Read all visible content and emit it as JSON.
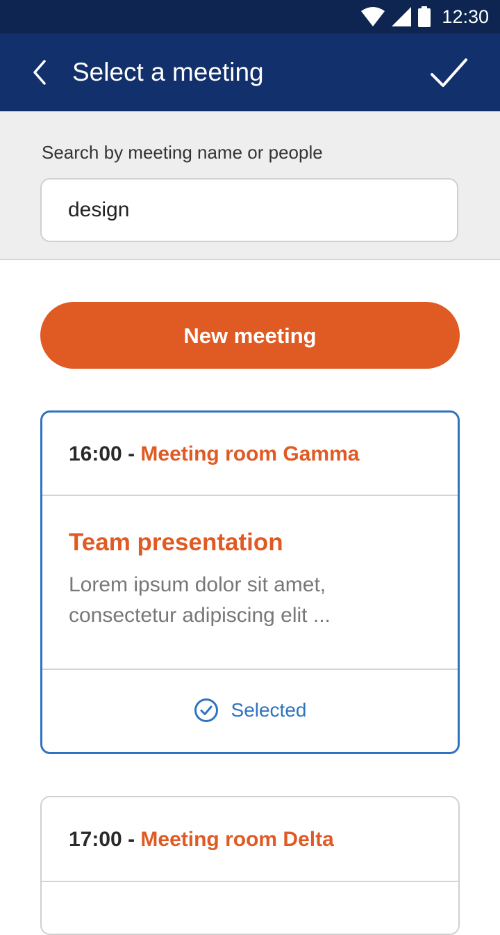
{
  "status_bar": {
    "time": "12:30",
    "icons": [
      "wifi-icon",
      "signal-icon",
      "battery-icon"
    ]
  },
  "app_bar": {
    "title": "Select a meeting",
    "back_icon": "chevron-left-icon",
    "confirm_icon": "check-icon"
  },
  "search": {
    "label": "Search by meeting name or people",
    "value": "design"
  },
  "new_meeting_label": "New meeting",
  "meetings": [
    {
      "time": "16:00",
      "separator": " - ",
      "room": "Meeting room Gamma",
      "name": "Team presentation",
      "description": "Lorem ipsum dolor sit amet, consectetur adipiscing elit ...",
      "status": "Selected"
    },
    {
      "time": "17:00",
      "separator": " - ",
      "room": "Meeting room Delta"
    }
  ],
  "colors": {
    "status_bar": "#0d2550",
    "app_bar": "#12306b",
    "accent": "#e05a24",
    "selected": "#2f74bf"
  }
}
